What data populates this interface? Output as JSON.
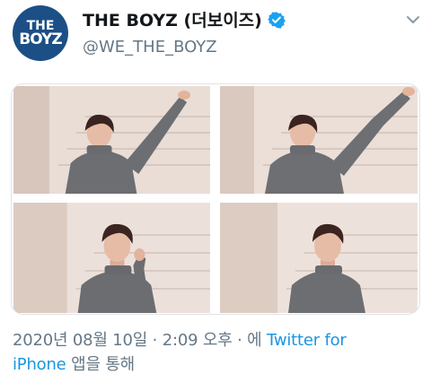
{
  "profile": {
    "avatar_text_top": "THE",
    "avatar_text_bottom": "BOYZ",
    "display_name": "THE BOYZ (더보이즈)",
    "handle": "@WE_THE_BOYZ",
    "verified_icon": "verified-badge-icon",
    "menu_icon": "chevron-down-icon"
  },
  "media": {
    "photos": [
      {
        "alt": "photo 1"
      },
      {
        "alt": "photo 2"
      },
      {
        "alt": "photo 3"
      },
      {
        "alt": "photo 4"
      }
    ]
  },
  "meta": {
    "timestamp": "2020년 08월 10일 · 2:09 오후",
    "separator": " · 에 ",
    "source_part1": "Twitter for",
    "source_part2": "iPhone",
    "suffix": " 앱을 통해"
  },
  "colors": {
    "link": "#1b95e0",
    "secondary_text": "#657786",
    "verified": "#1da1f2",
    "avatar_bg": "#1c4f86"
  }
}
